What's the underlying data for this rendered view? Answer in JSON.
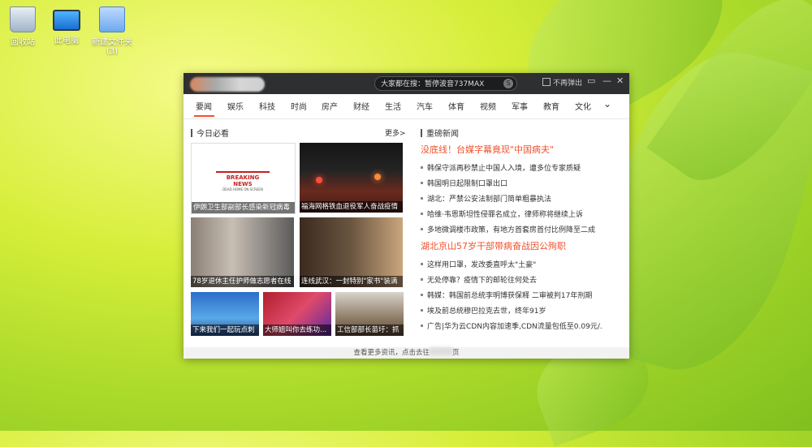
{
  "desktop": {
    "icons": [
      {
        "label": "回收站",
        "icon": "recycle-bin-icon"
      },
      {
        "label": "此电脑",
        "icon": "computer-icon"
      },
      {
        "label": "新建文件夹",
        "label2": "(3)",
        "icon": "folder-icon"
      }
    ]
  },
  "window": {
    "search_text": "大家都在搜：暂停波音737MAX",
    "no_popup_label": "不再弹出",
    "tabs": [
      "要闻",
      "娱乐",
      "科技",
      "时尚",
      "房产",
      "财经",
      "生活",
      "汽车",
      "体育",
      "视频",
      "军事",
      "教育",
      "文化"
    ],
    "left_section_title": "今日必看",
    "more_label": "更多>",
    "right_section_title": "重磅新闻",
    "thumbs": [
      {
        "caption": "伊朗卫生部副部长感染新冠病毒",
        "inner": "BREAKING NEWS",
        "sub": "DEAD HOME ON SCREEN"
      },
      {
        "caption": "福海网格铁血退役军人奋战疫情"
      },
      {
        "caption": "78岁退休主任护师做志愿者在线"
      },
      {
        "caption": "连线武汉：一封特别\"家书\"装满"
      },
      {
        "caption": "下来我们一起玩点刺"
      },
      {
        "caption": "大师姐叫你去练功..."
      },
      {
        "caption": "工信部部长苗圩：抓"
      }
    ],
    "headlines": [
      "没底线！台媒字幕竟现\"中国病夫\"",
      "湖北京山57岁干部带病奋战因公殉职"
    ],
    "news_group1": [
      "韩保守派再秒禁止中国人入境，遭多位专家质疑",
      "韩国明日起限制口罩出口",
      "湖北：严禁公安法制部门简单粗暴执法",
      "哈维·韦恩斯坦性侵罪名成立，律师称将继续上诉",
      "多地微调楼市政策，有地方首套房首付比例降至二成"
    ],
    "news_group2": [
      "这样用口罩，发改委直呼太\"土豪\"",
      "无处停靠？疫情下的邮轮往何处去",
      "韩媒：韩国前总统李明博获保释 二审被判17年刑期",
      "埃及前总统穆巴拉克去世，终年91岁",
      "广告|华为云CDN内容加速季,CDN流量包低至0.09元/."
    ],
    "footer_text_a": "查看更多资讯，点击去往",
    "footer_text_b": "页"
  }
}
